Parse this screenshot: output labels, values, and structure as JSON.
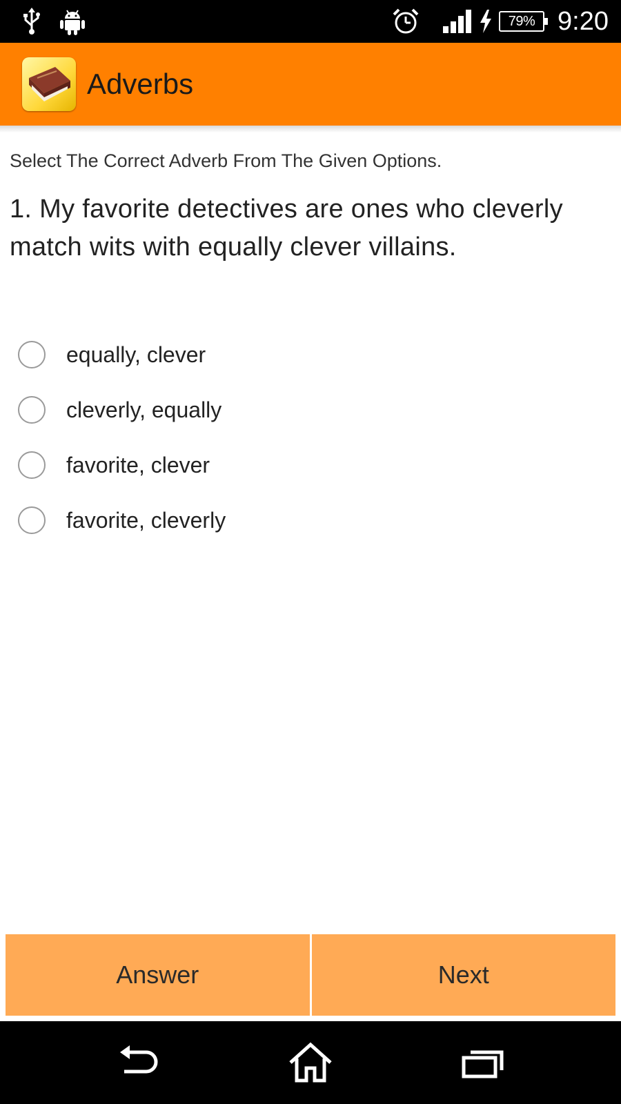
{
  "status_bar": {
    "time": "9:20",
    "battery_percent": "79%",
    "icons": [
      "usb-icon",
      "android-icon",
      "alarm-icon",
      "signal-icon",
      "charging-icon",
      "battery-icon"
    ]
  },
  "action_bar": {
    "title": "Adverbs",
    "icon": "book-app-icon",
    "color": "#ff8000"
  },
  "quiz": {
    "instruction": "Select The Correct Adverb From The Given Options.",
    "question": "1.  My favorite detectives are ones who cleverly match wits with equally clever villains.",
    "options": [
      {
        "label": "equally, clever",
        "selected": false
      },
      {
        "label": "cleverly, equally",
        "selected": false
      },
      {
        "label": "favorite, clever",
        "selected": false
      },
      {
        "label": "favorite, cleverly",
        "selected": false
      }
    ]
  },
  "buttons": {
    "answer_label": "Answer",
    "next_label": "Next",
    "color": "#ffaa55"
  },
  "nav_bar": {
    "icons": [
      "back-icon",
      "home-icon",
      "recents-icon"
    ]
  }
}
